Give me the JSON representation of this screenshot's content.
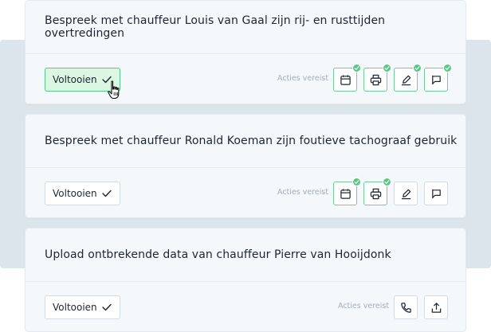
{
  "complete_label": "Voltooien",
  "actions_required_label": "Acties vereist",
  "colors": {
    "accent_green": "#57c885",
    "done_bg": "#dcf6e4",
    "backdrop": "#dde5ec"
  },
  "tasks": [
    {
      "title": "Bespreek met chauffeur Louis van Gaal zijn rij- en rusttijden overtredingen",
      "completed": true,
      "actions": [
        {
          "icon": "calendar-icon",
          "done": true
        },
        {
          "icon": "printer-icon",
          "done": true
        },
        {
          "icon": "pen-icon",
          "done": true
        },
        {
          "icon": "comment-icon",
          "done": true
        }
      ]
    },
    {
      "title": "Bespreek met chauffeur Ronald Koeman zijn foutieve tachograaf gebruik",
      "completed": false,
      "actions": [
        {
          "icon": "calendar-icon",
          "done": true
        },
        {
          "icon": "printer-icon",
          "done": true
        },
        {
          "icon": "pen-icon",
          "done": false
        },
        {
          "icon": "comment-icon",
          "done": false
        }
      ]
    },
    {
      "title": "Upload ontbrekende data van chauffeur Pierre van Hooijdonk",
      "completed": false,
      "actions": [
        {
          "icon": "phone-icon",
          "done": false
        },
        {
          "icon": "upload-icon",
          "done": false
        }
      ]
    }
  ]
}
